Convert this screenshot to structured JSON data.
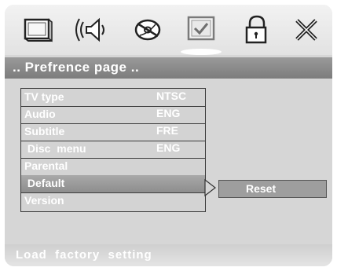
{
  "toolbar": {
    "icons": [
      {
        "name": "monitor-icon"
      },
      {
        "name": "speaker-audio-icon"
      },
      {
        "name": "disc-icon"
      },
      {
        "name": "preference-check-icon",
        "selected": true
      },
      {
        "name": "lock-icon"
      },
      {
        "name": "exit-icon"
      }
    ]
  },
  "page": {
    "title": ".. Prefrence  page .."
  },
  "menu": {
    "items": [
      {
        "label": "TV  type",
        "value": "NTSC"
      },
      {
        "label": "Audio",
        "value": "ENG"
      },
      {
        "label": "Subtitle",
        "value": "FRE"
      },
      {
        "label": " Disc  menu",
        "value": "ENG"
      },
      {
        "label": "Parental",
        "value": ""
      },
      {
        "label": " Default",
        "value": "",
        "highlighted": true
      },
      {
        "label": "Version",
        "value": ""
      }
    ]
  },
  "submenu": {
    "reset_label": "Reset"
  },
  "status": {
    "hint": "Load  factory  setting"
  },
  "colors": {
    "screen_bg": "#d6d6d6",
    "title_bg": "#8a8a8a",
    "highlight": "#9a9a9a",
    "text": "#ffffff",
    "border": "#3a3a3a"
  }
}
